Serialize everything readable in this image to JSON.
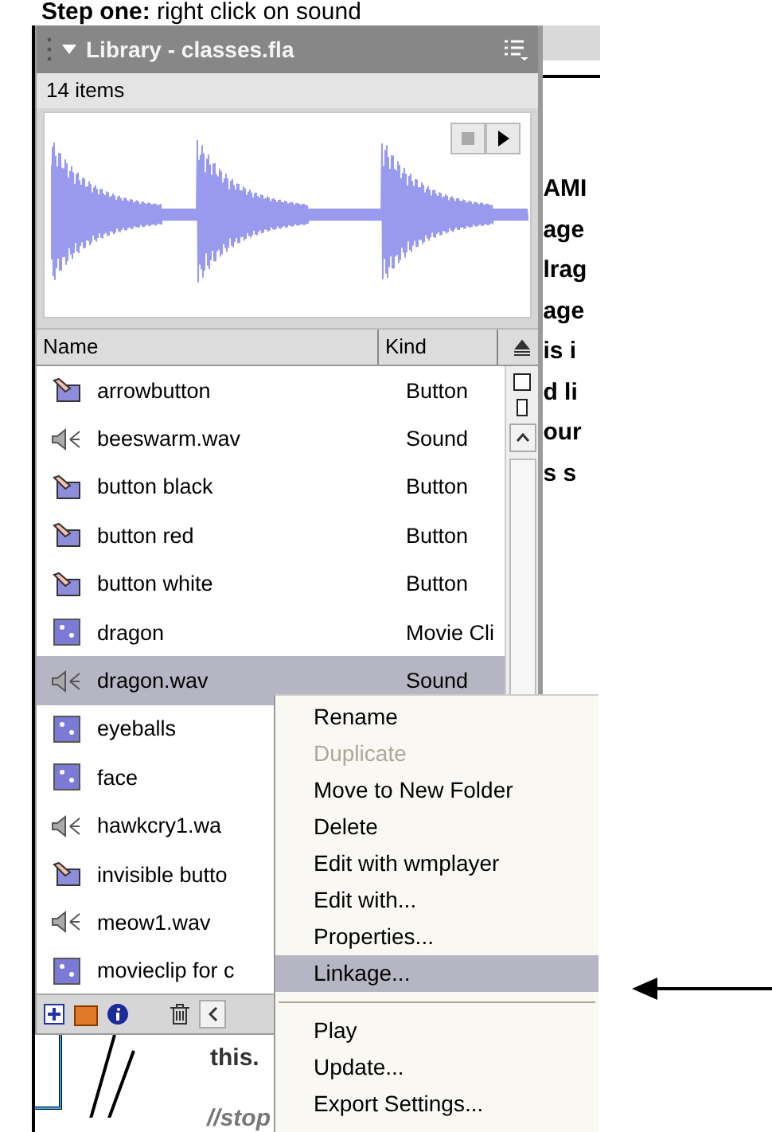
{
  "heading": "**Step one:** right click on sound",
  "library": {
    "title": "Library - classes.fla",
    "count": "14 items",
    "columns": [
      "Name",
      "Kind"
    ],
    "items": [
      {
        "kind": "button",
        "name": "arrowbutton",
        "type": "Button",
        "selected": false
      },
      {
        "kind": "sound",
        "name": "beeswarm.wav",
        "type": "Sound",
        "selected": false
      },
      {
        "kind": "button",
        "name": "button black",
        "type": "Button",
        "selected": false
      },
      {
        "kind": "button",
        "name": "button red",
        "type": "Button",
        "selected": false
      },
      {
        "kind": "button",
        "name": "button white",
        "type": "Button",
        "selected": false
      },
      {
        "kind": "movieclip",
        "name": "dragon",
        "type": "Movie Cli",
        "selected": false
      },
      {
        "kind": "sound",
        "name": "dragon.wav",
        "type": "Sound",
        "selected": true
      },
      {
        "kind": "movieclip",
        "name": "eyeballs",
        "selected": false
      },
      {
        "kind": "movieclip",
        "name": "face",
        "selected": false
      },
      {
        "kind": "sound",
        "name": "hawkcry1.wa",
        "selected": false
      },
      {
        "kind": "button",
        "name": "invisible butto",
        "selected": false
      },
      {
        "kind": "sound",
        "name": "meow1.wav",
        "selected": false
      },
      {
        "kind": "movieclip",
        "name": "movieclip for c",
        "selected": false
      }
    ]
  },
  "document": {
    "fragments": [
      "AMI",
      "age",
      "lrag",
      "age",
      "is i",
      "d li",
      "our",
      "s s"
    ],
    "code": [
      {
        "kind": "bold",
        "text": "this."
      },
      {
        "kind": "comment",
        "text": "//stop"
      }
    ]
  },
  "context_menu": [
    {
      "kind": "item",
      "label": "Rename",
      "disabled": false,
      "selected": false
    },
    {
      "kind": "item",
      "label": "Duplicate",
      "disabled": true,
      "selected": false
    },
    {
      "kind": "item",
      "label": "Move to New Folder",
      "disabled": false,
      "selected": false
    },
    {
      "kind": "item",
      "label": "Delete",
      "disabled": false,
      "selected": false
    },
    {
      "kind": "item",
      "label": "Edit with wmplayer",
      "disabled": false,
      "selected": false
    },
    {
      "kind": "item",
      "label": "Edit with...",
      "disabled": false,
      "selected": false
    },
    {
      "kind": "item",
      "label": "Properties...",
      "disabled": false,
      "selected": false
    },
    {
      "kind": "item",
      "label": "Linkage...",
      "disabled": false,
      "selected": true
    },
    {
      "kind": "separator"
    },
    {
      "kind": "item",
      "label": "Play",
      "disabled": false,
      "selected": false
    },
    {
      "kind": "item",
      "label": "Update...",
      "disabled": false,
      "selected": false
    },
    {
      "kind": "item",
      "label": "Export Settings...",
      "disabled": false,
      "selected": false
    }
  ]
}
